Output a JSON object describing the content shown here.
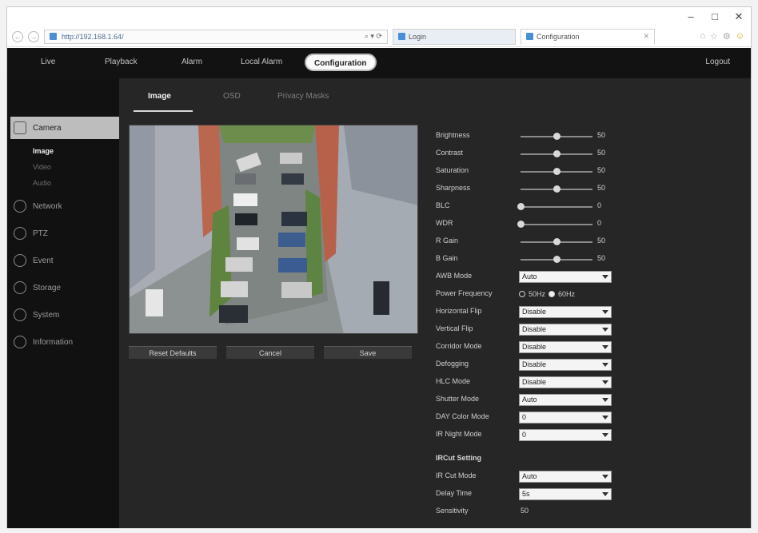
{
  "browser": {
    "url": "http://192.168.1.64/",
    "addr_tools": "⌕ ▾ ⟳",
    "tab1": "Login",
    "tab2": "Configuration",
    "window_controls": [
      "–",
      "□",
      "✕"
    ]
  },
  "topnav": {
    "items": [
      "Live",
      "Playback",
      "Alarm",
      "Local Alarm",
      "Configuration"
    ],
    "active": "Configuration",
    "logout": "Logout"
  },
  "sidebar": {
    "items": [
      {
        "label": "Camera",
        "icon": "camera-icon",
        "active": true
      },
      {
        "label": "Network",
        "icon": "network-icon"
      },
      {
        "label": "PTZ",
        "icon": "ptz-icon"
      },
      {
        "label": "Event",
        "icon": "event-icon"
      },
      {
        "label": "Storage",
        "icon": "storage-icon"
      },
      {
        "label": "System",
        "icon": "system-icon"
      },
      {
        "label": "Information",
        "icon": "info-icon"
      }
    ],
    "sub_items": [
      "Image",
      "Video",
      "Audio"
    ],
    "active_sub": "Image"
  },
  "subtabs": [
    "Image",
    "OSD",
    "Privacy Masks"
  ],
  "video_buttons": [
    "Reset Defaults",
    "Cancel",
    "Save"
  ],
  "sliders": [
    {
      "label": "Brightness",
      "value": 50,
      "max": 100
    },
    {
      "label": "Contrast",
      "value": 50,
      "max": 100
    },
    {
      "label": "Saturation",
      "value": 50,
      "max": 100
    },
    {
      "label": "Sharpness",
      "value": 50,
      "max": 100
    },
    {
      "label": "BLC",
      "value": 0,
      "max": 100
    },
    {
      "label": "WDR",
      "value": 0,
      "max": 100
    },
    {
      "label": "R Gain",
      "value": 50,
      "max": 100
    },
    {
      "label": "B Gain",
      "value": 50,
      "max": 100
    }
  ],
  "settings": {
    "awb_mode": {
      "label": "AWB Mode",
      "value": "Auto"
    },
    "power_frequency": {
      "label": "Power Frequency",
      "options": [
        "50Hz",
        "60Hz"
      ],
      "selected": "60Hz"
    },
    "horizontal_flip": {
      "label": "Horizontal Flip",
      "value": "Disable"
    },
    "vertical_flip": {
      "label": "Vertical Flip",
      "value": "Disable"
    },
    "corridor_mode": {
      "label": "Corridor Mode",
      "value": "Disable"
    },
    "defogging": {
      "label": "Defogging",
      "value": "Disable"
    },
    "hlc_mode": {
      "label": "HLC Mode",
      "value": "Disable"
    },
    "shutter_mode": {
      "label": "Shutter Mode",
      "value": "Auto"
    },
    "day_color_mode": {
      "label": "DAY Color Mode",
      "value": "0"
    },
    "ir_night_mode": {
      "label": "IR Night Mode",
      "value": "0"
    }
  },
  "ir_cut": {
    "title": "IRCut Setting",
    "mode": {
      "label": "IR Cut Mode",
      "value": "Auto"
    },
    "delay": {
      "label": "Delay Time",
      "value": "5s"
    },
    "sensitivity": {
      "label": "Sensitivity",
      "value": "50"
    }
  },
  "colors": {
    "accent_bg": "#bdbdbd",
    "panel": "#262626",
    "nav": "#121212"
  }
}
